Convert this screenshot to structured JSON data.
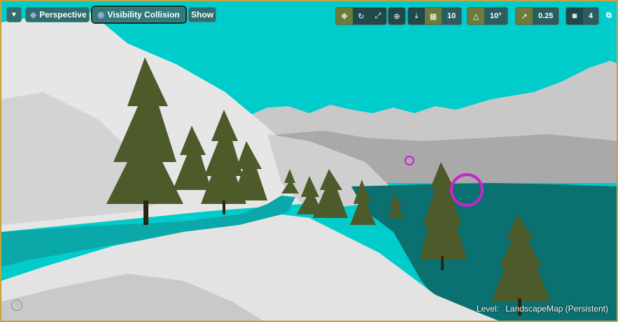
{
  "toolbar": {
    "menu_icon": "chevron-down-icon",
    "perspective_label": "Perspective",
    "view_mode_label": "Visibility Collision",
    "show_label": "Show",
    "grid_snap_value": "10",
    "rotation_snap_value": "10°",
    "scale_snap_value": "0.25",
    "camera_speed_value": "4"
  },
  "status": {
    "level_prefix": "Level:",
    "level_name": "LandscapeMap (Persistent)"
  },
  "help_glyph": "?",
  "colors": {
    "sky": "#00cccc",
    "water": "#0a7070",
    "snow": "#d8d8d8",
    "selection_border": "#c8a23c"
  }
}
